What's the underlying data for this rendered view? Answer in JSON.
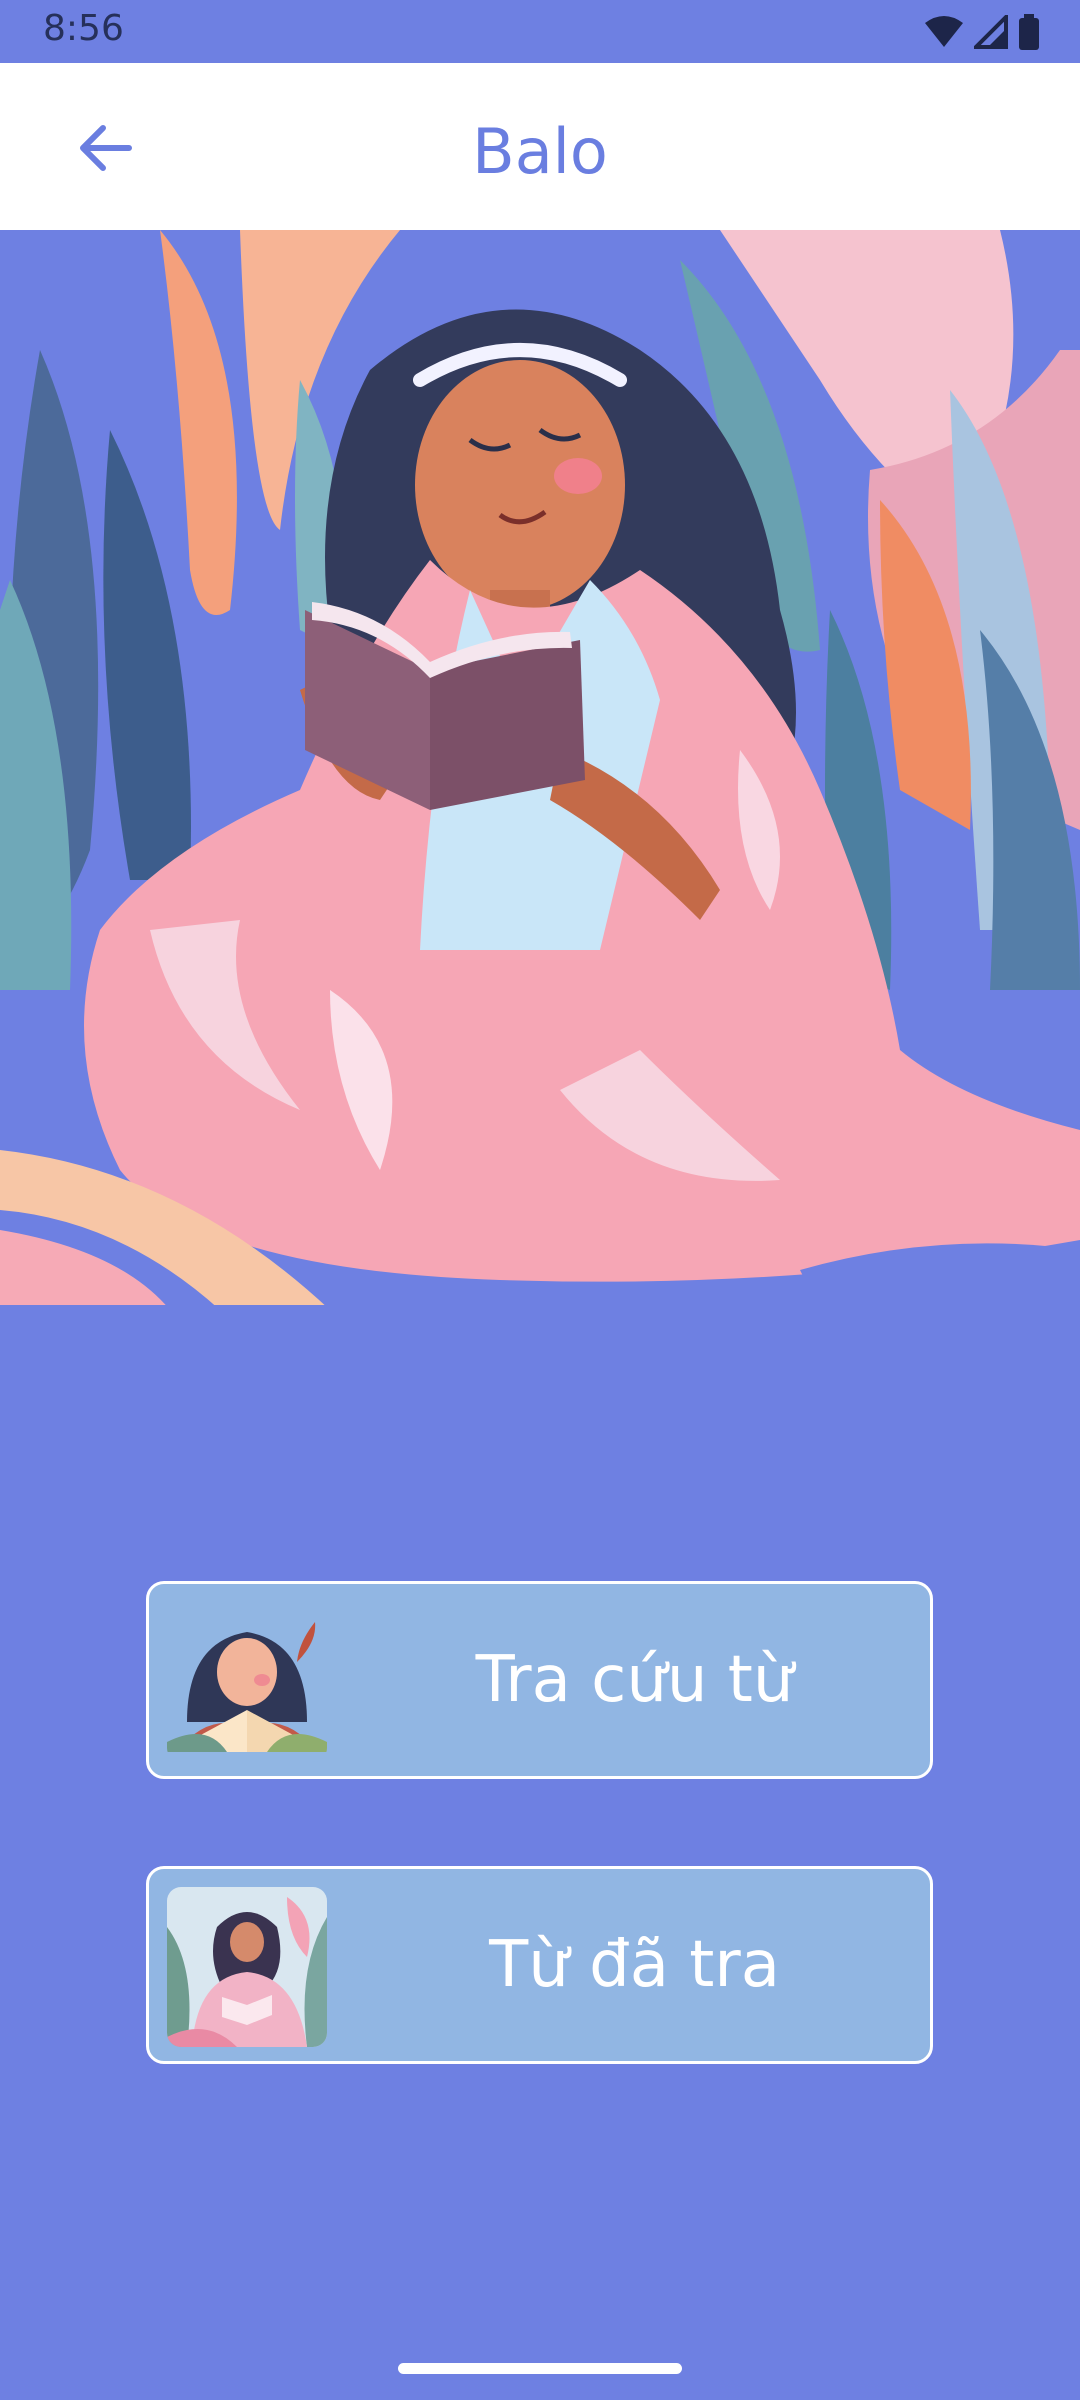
{
  "status_bar": {
    "time": "8:56",
    "icons": [
      "wifi-icon",
      "cellular-signal-icon",
      "battery-icon"
    ]
  },
  "app_bar": {
    "title": "Balo",
    "back_icon": "arrow-left-icon"
  },
  "hero": {
    "description_icon": "girl-reading-illustration"
  },
  "menu": [
    {
      "label": "Tra cứu từ",
      "thumbnail": "girl-with-open-book-thumbnail"
    },
    {
      "label": "Từ đã tra",
      "thumbnail": "girl-reading-thumbnail"
    }
  ],
  "colors": {
    "background": "#6e80e2",
    "accent": "#6a7ee0",
    "button_fill": "#91b6e3",
    "app_bar": "#ffffff"
  }
}
